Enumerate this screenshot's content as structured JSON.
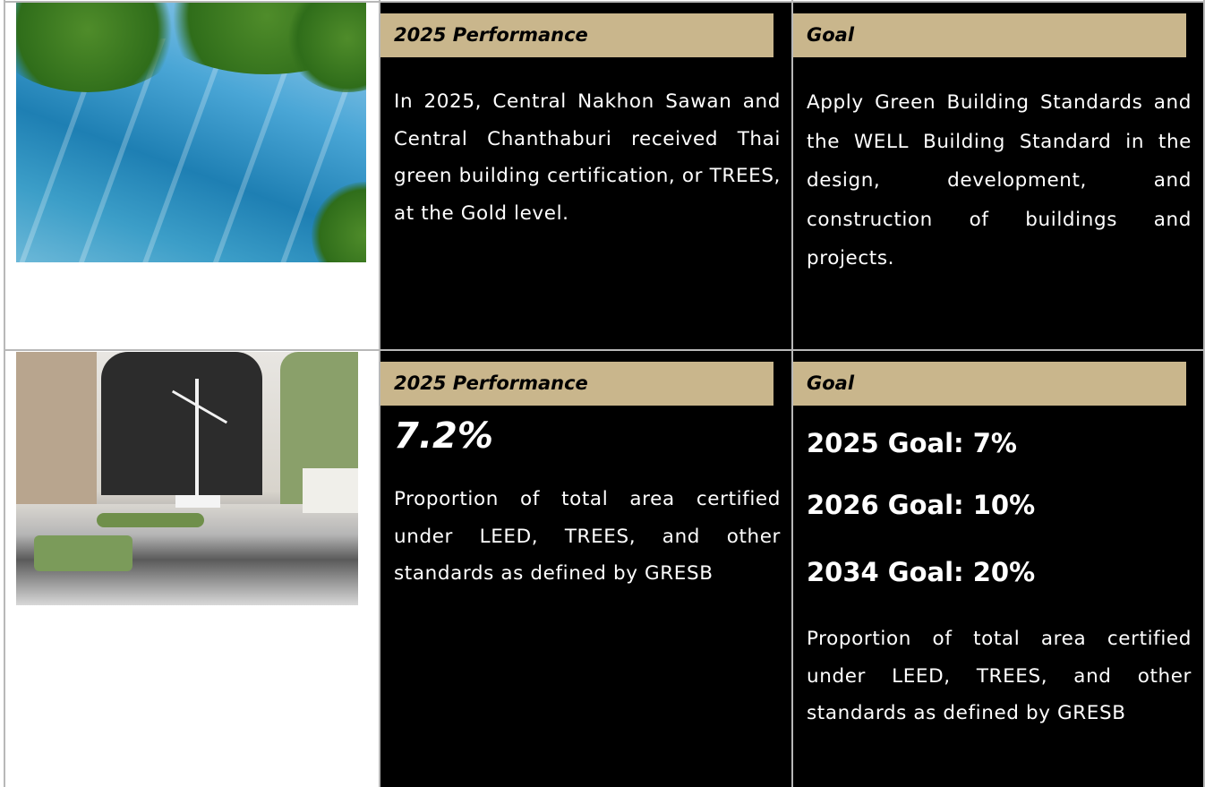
{
  "rows": [
    {
      "image": "glass-building-photo",
      "performance": {
        "label": "2025 Performance",
        "text": "In 2025, Central Nakhon Sawan and Central Chanthaburi received Thai green building certification, or TREES, at the Gold level."
      },
      "goal": {
        "label": "Goal",
        "text": "Apply Green Building Standards and the WELL Building Standard in the design, development, and construction of buildings and projects."
      }
    },
    {
      "image": "wind-turbine-model-photo",
      "performance": {
        "label": "2025 Performance",
        "value": "7.2%",
        "text": "Proportion of total area certified under LEED, TREES, and other standards as defined by GRESB"
      },
      "goal": {
        "label": "Goal",
        "goals": [
          "2025 Goal: 7%",
          "2026 Goal: 10%",
          "2034 Goal: 20%"
        ],
        "text": "Proportion of total area certified under LEED, TREES, and other standards as defined by GRESB"
      }
    }
  ],
  "colors": {
    "label_bg": "#c9b68c",
    "panel_bg": "#000000",
    "text_light": "#ffffff",
    "border": "#b8b8b8"
  }
}
